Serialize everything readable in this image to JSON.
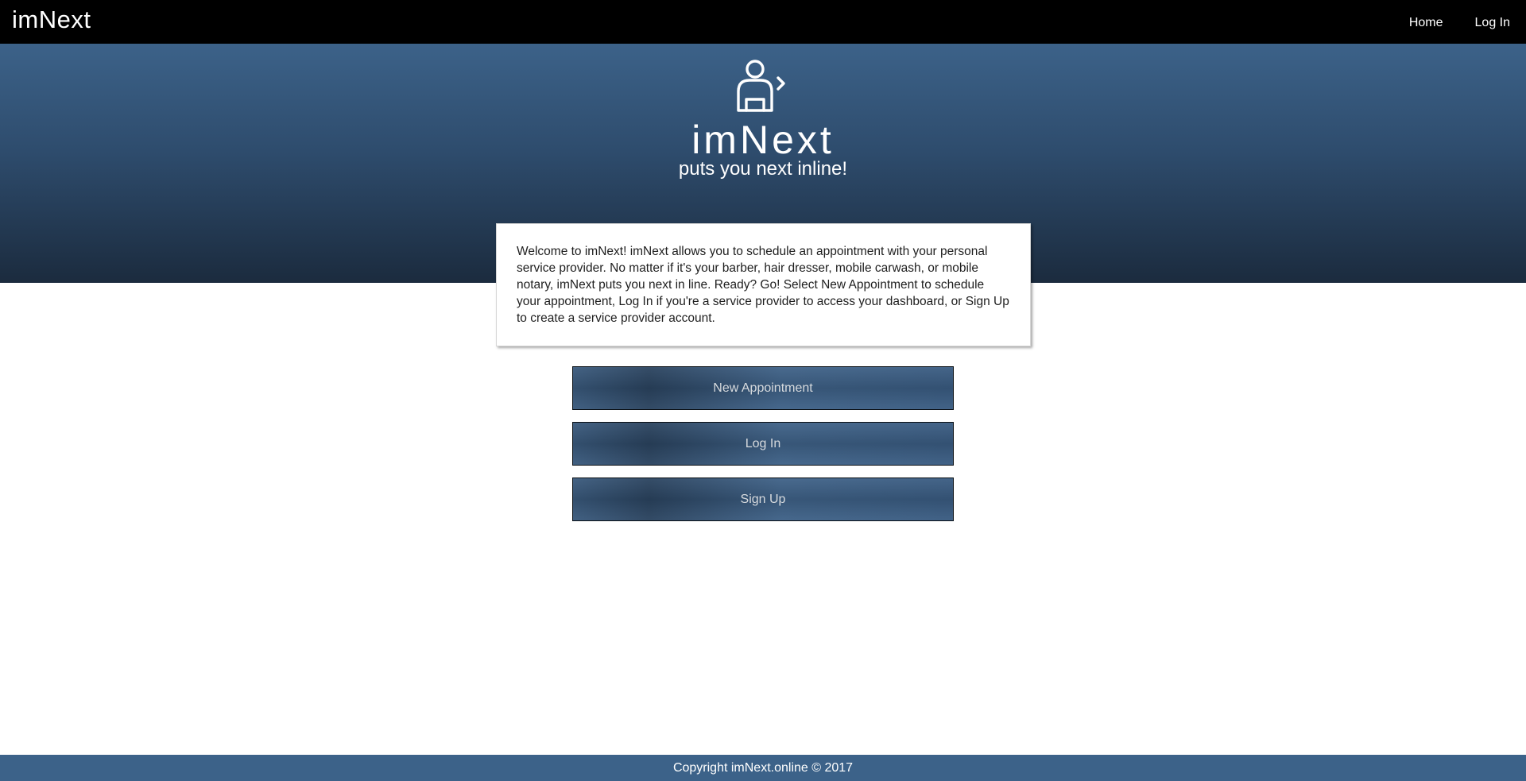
{
  "navbar": {
    "brand": "imNext",
    "links": [
      {
        "label": "Home"
      },
      {
        "label": "Log In"
      }
    ]
  },
  "hero": {
    "icon": "user-next-icon",
    "title": "imNext",
    "tagline": "puts you next inline!"
  },
  "welcome": {
    "text": "Welcome to imNext! imNext allows you to schedule an appointment with your personal service provider. No matter if it's your barber, hair dresser, mobile carwash, or mobile notary, imNext puts you next in line. Ready? Go! Select New Appointment to schedule your appointment, Log In if you're a service provider to access your dashboard, or Sign Up to create a service provider account."
  },
  "actions": {
    "new_appointment": "New Appointment",
    "log_in": "Log In",
    "sign_up": "Sign Up"
  },
  "footer": {
    "text": "Copyright imNext.online © 2017"
  },
  "colors": {
    "navbar": "#000000",
    "hero_top": "#3c6289",
    "hero_bottom": "#1b2b3e",
    "button": "#3a5c82",
    "footer": "#3c6289"
  }
}
